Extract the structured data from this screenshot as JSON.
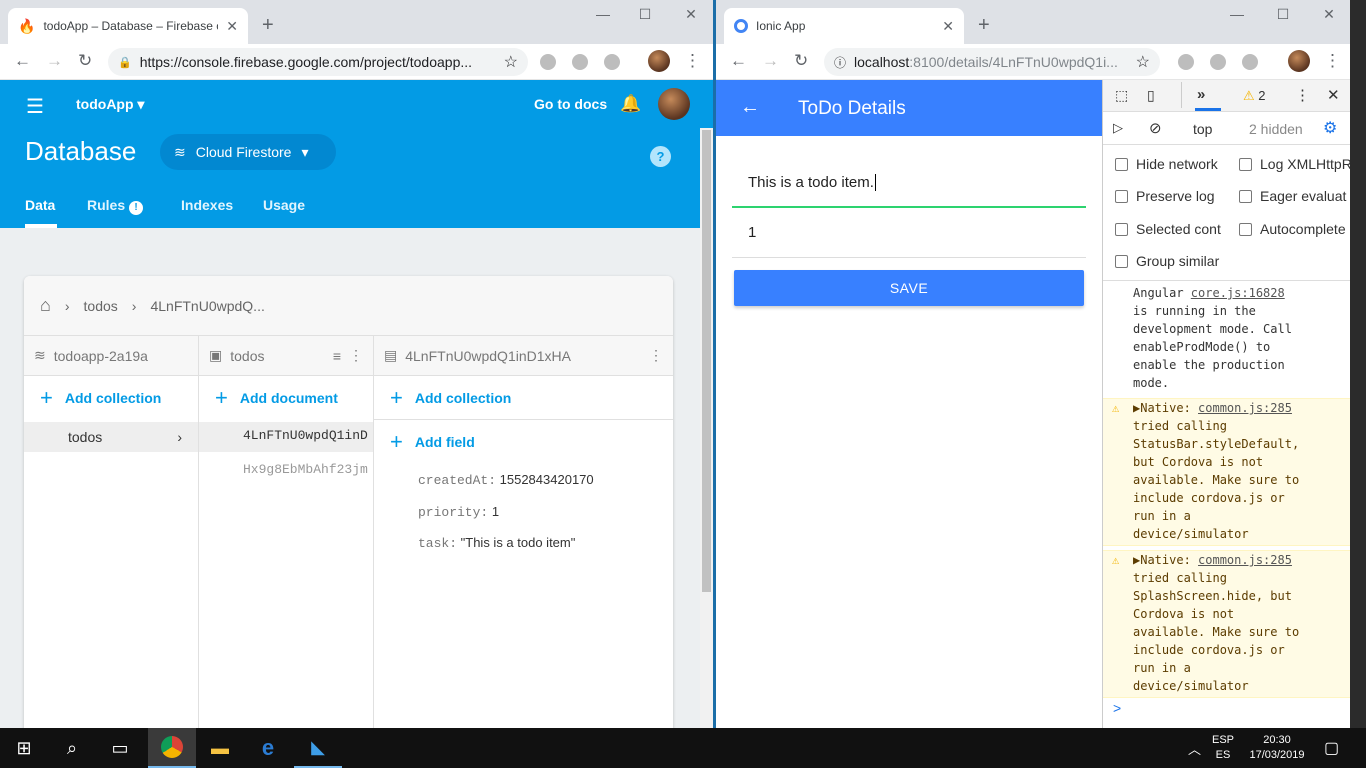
{
  "left_browser": {
    "tab_title": "todoApp – Database – Firebase c",
    "url": "https://console.firebase.google.com/project/todoapp...",
    "app_name": "todoApp",
    "go_to_docs": "Go to docs",
    "page_title": "Database",
    "db_selector": "Cloud Firestore",
    "tabs": [
      "Data",
      "Rules",
      "Indexes",
      "Usage"
    ],
    "breadcrumb": [
      "todos",
      "4LnFTnU0wpdQ..."
    ],
    "columns": {
      "project": "todoapp-2a19a",
      "collection": "todos",
      "document": "4LnFTnU0wpdQ1inD1xHA"
    },
    "add_collection": "Add collection",
    "add_document": "Add document",
    "add_field": "Add field",
    "collections": [
      "todos"
    ],
    "documents": [
      "4LnFTnU0wpdQ1inD",
      "Hx9g8EbMbAhf23jm"
    ],
    "fields": [
      {
        "key": "createdAt:",
        "value": "1552843420170"
      },
      {
        "key": "priority:",
        "value": "1"
      },
      {
        "key": "task:",
        "value": "\"This is a todo item\""
      }
    ]
  },
  "right_browser": {
    "tab_title": "Ionic App",
    "url_host": "localhost",
    "url_rest": ":8100/details/4LnFTnU0wpdQ1i...",
    "header_title": "ToDo Details",
    "task_value": "This is a todo item.",
    "priority_value": "1",
    "save_label": "SAVE"
  },
  "devtools": {
    "warn_count": "2",
    "context": "top",
    "hidden": "2 hidden",
    "options": [
      "Hide network",
      "Log XMLHttpR",
      "Preserve log",
      "Eager evaluat",
      "Selected cont",
      "Autocomplete",
      "Group similar"
    ],
    "messages": [
      {
        "text": "Angular ",
        "source": "core.js:16828",
        "rest": "\nis running in the\ndevelopment mode. Call\nenableProdMode() to\nenable the production\nmode."
      },
      {
        "text": "▶Native: ",
        "source": "common.js:285",
        "rest": "\ntried calling\nStatusBar.styleDefault,\nbut Cordova is not\navailable. Make sure to\ninclude cordova.js or\nrun in a\ndevice/simulator"
      },
      {
        "text": "▶Native: ",
        "source": "common.js:285",
        "rest": "\ntried calling\nSplashScreen.hide, but\nCordova is not\navailable. Make sure to\ninclude cordova.js or\nrun in a\ndevice/simulator"
      }
    ],
    "prompt": ">"
  },
  "taskbar": {
    "lang1": "ESP",
    "lang2": "ES",
    "time": "20:30",
    "date": "17/03/2019"
  },
  "colors": {
    "firebase_blue": "#039be5",
    "ionic_blue": "#3880ff",
    "warn_bg": "#fffbe5"
  }
}
